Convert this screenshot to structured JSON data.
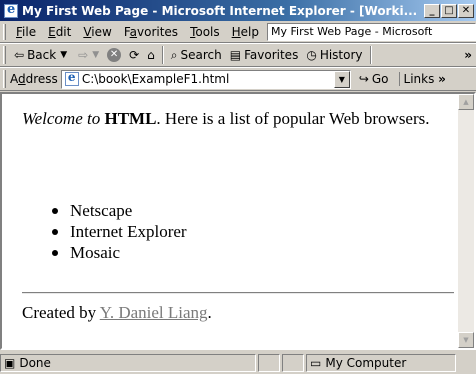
{
  "window": {
    "title": "My First Web Page - Microsoft Internet Explorer - [Worki...",
    "minimize_label": "_",
    "maximize_label": "□",
    "close_label": "✕"
  },
  "menu": {
    "items": [
      {
        "acc": "F",
        "rest": "ile"
      },
      {
        "acc": "E",
        "rest": "dit"
      },
      {
        "acc": "V",
        "rest": "iew"
      },
      {
        "pre": "F",
        "acc": "a",
        "rest": "vorites"
      },
      {
        "acc": "T",
        "rest": "ools"
      },
      {
        "acc": "H",
        "rest": "elp"
      }
    ],
    "page_title_field": "My First Web Page - Microsoft"
  },
  "toolbar": {
    "back_label": "Back",
    "search_label": "Search",
    "favorites_label": "Favorites",
    "history_label": "History",
    "overflow": "»"
  },
  "address": {
    "label_acc": "d",
    "label_pre": "A",
    "label_rest": "dress",
    "value": "C:\\book\\ExampleF1.html",
    "go_label": "Go",
    "links_label": "Links"
  },
  "page": {
    "intro_em": "Welcome to",
    "intro_strong": "HTML",
    "intro_rest": ". Here is a list of popular Web browsers.",
    "browsers": [
      "Netscape",
      "Internet Explorer",
      "Mosaic"
    ],
    "footer_prefix": "Created by ",
    "author_link": "Y. Daniel Liang",
    "footer_suffix": "."
  },
  "status": {
    "main_text": "Done",
    "zone_text": "My Computer"
  },
  "colors": {
    "titlebar_start": "#0a246a",
    "titlebar_end": "#a6caf0",
    "chrome": "#d4d0c8",
    "link": "#7a7a7a"
  }
}
